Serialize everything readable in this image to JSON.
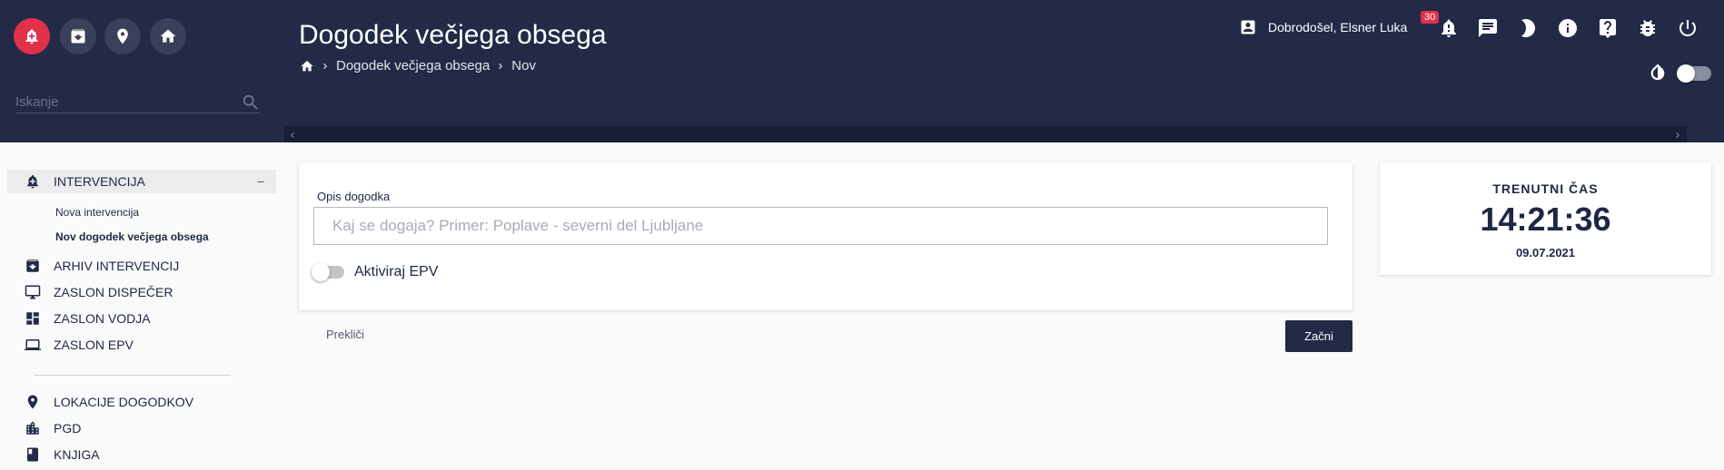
{
  "header": {
    "title": "Dogodek večjega obsega",
    "breadcrumb": [
      "Dogodek večjega obsega",
      "Nov"
    ],
    "search_placeholder": "Iskanje",
    "user_greeting": "Dobrodošel, Elsner Luka",
    "notification_count": "30",
    "accent_color": "#e0304a",
    "header_color": "#222a48",
    "quick_buttons": [
      "alarm-icon",
      "archive-icon",
      "location-icon",
      "home-icon"
    ],
    "top_icons": [
      "notifications-icon",
      "chat-icon",
      "dark-mode-icon",
      "info-icon",
      "help-icon",
      "bug-icon",
      "power-icon"
    ]
  },
  "sidebar": {
    "intervention": {
      "label": "INTERVENCIJA",
      "collapse_symbol": "−",
      "sub_items": [
        "Nova intervencija",
        "Nov dogodek večjega obsega"
      ]
    },
    "items": [
      {
        "label": "ARHIV INTERVENCIJ",
        "icon": "archive-icon"
      },
      {
        "label": "ZASLON DISPEČER",
        "icon": "monitor-icon"
      },
      {
        "label": "ZASLON VODJA",
        "icon": "dashboard-icon"
      },
      {
        "label": "ZASLON EPV",
        "icon": "laptop-icon"
      }
    ],
    "items2": [
      {
        "label": "LOKACIJE DOGODKOV",
        "icon": "location-icon"
      },
      {
        "label": "PGD",
        "icon": "building-icon"
      },
      {
        "label": "KNJIGA",
        "icon": "book-icon"
      }
    ]
  },
  "form": {
    "description_label": "Opis dogodka",
    "description_placeholder": "Kaj se dogaja? Primer: Poplave - severni del Ljubljane",
    "description_value": "",
    "epv_toggle_label": "Aktiviraj EPV",
    "epv_enabled": false,
    "cancel_label": "Prekliči",
    "start_label": "Začni"
  },
  "clock": {
    "title": "TRENUTNI ČAS",
    "time": "14:21:36",
    "date": "09.07.2021"
  }
}
